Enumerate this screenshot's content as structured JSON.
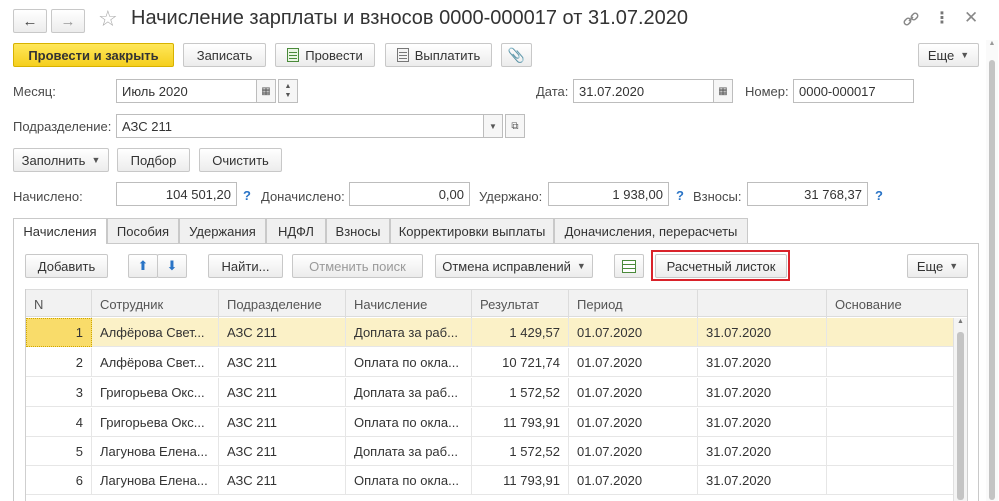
{
  "window": {
    "title": "Начисление зарплаты и взносов 0000-000017 от 31.07.2020"
  },
  "toolbar": {
    "post_close": "Провести и закрыть",
    "save": "Записать",
    "post": "Провести",
    "pay": "Выплатить",
    "more": "Еще"
  },
  "header": {
    "month_label": "Месяц:",
    "month_value": "Июль 2020",
    "date_label": "Дата:",
    "date_value": "31.07.2020",
    "number_label": "Номер:",
    "number_value": "0000-000017",
    "division_label": "Подразделение:",
    "division_value": "АЗС 211"
  },
  "actions": {
    "fill": "Заполнить",
    "select": "Подбор",
    "clear": "Очистить"
  },
  "totals": {
    "accrued_label": "Начислено:",
    "accrued_value": "104 501,20",
    "extra_label": "Доначислено:",
    "extra_value": "0,00",
    "withheld_label": "Удержано:",
    "withheld_value": "1 938,00",
    "contrib_label": "Взносы:",
    "contrib_value": "31 768,37",
    "help": "?"
  },
  "tabs": [
    {
      "label": "Начисления"
    },
    {
      "label": "Пособия"
    },
    {
      "label": "Удержания"
    },
    {
      "label": "НДФЛ"
    },
    {
      "label": "Взносы"
    },
    {
      "label": "Корректировки выплаты"
    },
    {
      "label": "Доначисления, перерасчеты"
    }
  ],
  "table_toolbar": {
    "add": "Добавить",
    "find": "Найти...",
    "cancel_search": "Отменить поиск",
    "cancel_corrections": "Отмена исправлений",
    "payslip": "Расчетный листок",
    "more": "Еще"
  },
  "table": {
    "columns": [
      "N",
      "Сотрудник",
      "Подразделение",
      "Начисление",
      "Результат",
      "Период",
      "",
      "Основание"
    ],
    "rows": [
      [
        "1",
        "Алфёрова Свет...",
        "АЗС 211",
        "Доплата за раб...",
        "1 429,57",
        "01.07.2020",
        "31.07.2020",
        ""
      ],
      [
        "2",
        "Алфёрова Свет...",
        "АЗС 211",
        "Оплата по окла...",
        "10 721,74",
        "01.07.2020",
        "31.07.2020",
        ""
      ],
      [
        "3",
        "Григорьева Окс...",
        "АЗС 211",
        "Доплата за раб...",
        "1 572,52",
        "01.07.2020",
        "31.07.2020",
        ""
      ],
      [
        "4",
        "Григорьева Окс...",
        "АЗС 211",
        "Оплата по окла...",
        "11 793,91",
        "01.07.2020",
        "31.07.2020",
        ""
      ],
      [
        "5",
        "Лагунова Елена...",
        "АЗС 211",
        "Доплата за раб...",
        "1 572,52",
        "01.07.2020",
        "31.07.2020",
        ""
      ],
      [
        "6",
        "Лагунова Елена...",
        "АЗС 211",
        "Оплата по окла...",
        "11 793,91",
        "01.07.2020",
        "31.07.2020",
        ""
      ]
    ]
  },
  "colors": {
    "accent_yellow": "#f5cf1e",
    "selected_row": "#fbf1c7",
    "highlight_red": "#d9222a",
    "link_blue": "#2a74c6"
  }
}
